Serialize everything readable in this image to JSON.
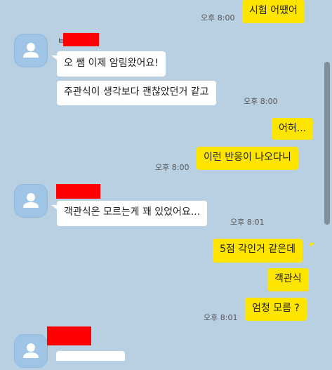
{
  "colors": {
    "background": "#b9cfe2",
    "my_bubble": "#fee500",
    "their_bubble": "#ffffff",
    "redaction": "#ff0000"
  },
  "messages": [
    {
      "side": "me",
      "text": "시험 어땠어",
      "time": "오후 8:00"
    },
    {
      "side": "them",
      "sender_initial": "ㅂ",
      "text": "오 쌤 이제 암림왔어요!"
    },
    {
      "side": "them",
      "text": "주관식이 생각보다 괜찮았던거 같고",
      "time": "오후 8:00"
    },
    {
      "side": "me",
      "text": "어허..."
    },
    {
      "side": "me",
      "text": "이런 반응이 나오다니",
      "time": "오후 8:00"
    },
    {
      "side": "them",
      "text": "객관식은 모르는게 꽤 있었어요...",
      "time": "오후 8:01"
    },
    {
      "side": "me",
      "text": "5점 각인거 같은데"
    },
    {
      "side": "me",
      "text": "객관식"
    },
    {
      "side": "me",
      "text": "엄청 모름 ?",
      "time": "오후 8:01"
    }
  ],
  "icons": {
    "avatar": "person-icon"
  }
}
